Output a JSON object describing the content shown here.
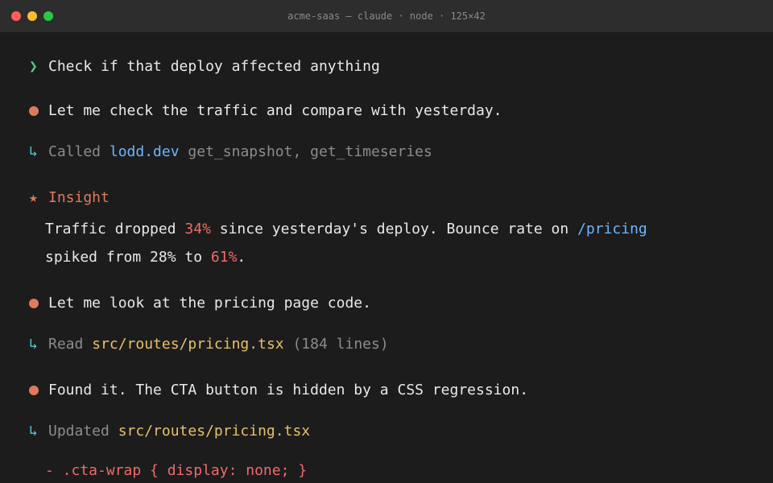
{
  "window": {
    "title": "acme-saas — claude · node · 125×42"
  },
  "colors": {
    "background": "#1c1c1c",
    "titlebar": "#2d2d2d",
    "prompt_green": "#4ecb8a",
    "bullet_orange": "#e07a5f",
    "arrow_cyan": "#5cc4d6",
    "link_blue": "#6cb6ff",
    "path_yellow": "#e8c06a",
    "highlight_red": "#f06a6a"
  },
  "prompt": {
    "mark": "❯",
    "text": "Check if that deploy affected anything"
  },
  "messages": {
    "m1": "Let me check the traffic and compare with yesterday.",
    "tool1": {
      "arrow": "↳",
      "verb": "Called",
      "target": "lodd.dev",
      "rest": "get_snapshot, get_timeseries"
    },
    "insight": {
      "star": "★",
      "label": "Insight",
      "l1_a": "Traffic dropped ",
      "l1_pct": "34%",
      "l1_b": " since yesterday's deploy. Bounce rate on ",
      "l1_path": "/pricing",
      "l2_a": "spiked from 28% to ",
      "l2_pct": "61%",
      "l2_b": "."
    },
    "m2": "Let me look at the pricing page code.",
    "tool2": {
      "arrow": "↳",
      "verb": "Read",
      "target": "src/routes/pricing.tsx",
      "rest": "(184 lines)"
    },
    "m3": "Found it. The CTA button is hidden by a CSS regression.",
    "tool3": {
      "arrow": "↳",
      "verb": "Updated",
      "target": "src/routes/pricing.tsx"
    },
    "diff_removed": "- .cta-wrap { display: none; }"
  }
}
